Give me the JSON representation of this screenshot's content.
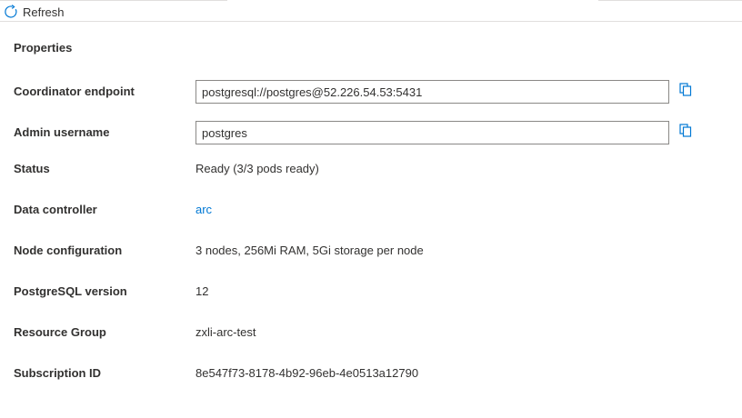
{
  "toolbar": {
    "refresh_label": "Refresh"
  },
  "properties": {
    "title": "Properties",
    "coordinator_endpoint": {
      "label": "Coordinator endpoint",
      "value": "postgresql://postgres@52.226.54.53:5431"
    },
    "admin_username": {
      "label": "Admin username",
      "value": "postgres"
    },
    "status": {
      "label": "Status",
      "value": "Ready (3/3 pods ready)"
    },
    "data_controller": {
      "label": "Data controller",
      "value": "arc"
    },
    "node_configuration": {
      "label": "Node configuration",
      "value": "3 nodes, 256Mi RAM, 5Gi storage per node"
    },
    "postgresql_version": {
      "label": "PostgreSQL version",
      "value": "12"
    },
    "resource_group": {
      "label": "Resource Group",
      "value": "zxli-arc-test"
    },
    "subscription_id": {
      "label": "Subscription ID",
      "value": "8e547f73-8178-4b92-96eb-4e0513a12790"
    }
  },
  "colors": {
    "accent": "#0078d4",
    "text": "#323130",
    "border": "#8a8886"
  },
  "icons": [
    "refresh-icon",
    "copy-icon"
  ]
}
